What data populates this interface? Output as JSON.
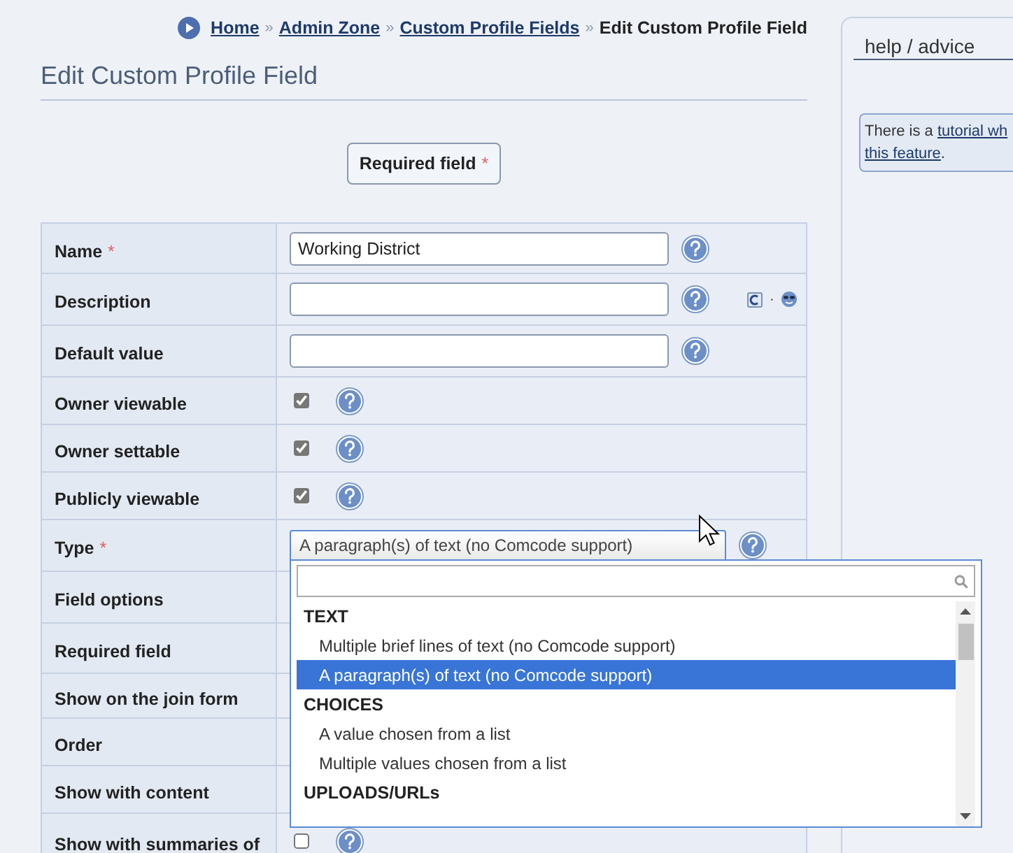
{
  "breadcrumb": {
    "links": [
      "Home",
      "Admin Zone",
      "Custom Profile Fields"
    ],
    "separator": "»",
    "current": "Edit Custom Profile Field"
  },
  "title": "Edit Custom Profile Field",
  "required_legend": {
    "label": "Required field",
    "mark": "*"
  },
  "fields": [
    {
      "label": "Name",
      "required": true,
      "kind": "text",
      "value": "Working District"
    },
    {
      "label": "Description",
      "required": false,
      "kind": "text_tools",
      "tools_separator": "·"
    },
    {
      "label": "Default value",
      "required": false,
      "kind": "text"
    },
    {
      "label": "Owner viewable",
      "required": false,
      "kind": "checkbox",
      "checked": true
    },
    {
      "label": "Owner settable",
      "required": false,
      "kind": "checkbox",
      "checked": true
    },
    {
      "label": "Publicly viewable",
      "required": false,
      "kind": "checkbox",
      "checked": true
    },
    {
      "label": "Type",
      "required": true,
      "kind": "select",
      "value": "A paragraph(s) of text (no Comcode support)",
      "open": true
    },
    {
      "label": "Field options",
      "required": false,
      "kind": "covered"
    },
    {
      "label": "Required field",
      "required": false,
      "kind": "covered"
    },
    {
      "label": "Show on the join form",
      "required": false,
      "kind": "covered"
    },
    {
      "label": "Order",
      "required": false,
      "kind": "covered"
    },
    {
      "label": "Show with content",
      "required": false,
      "kind": "covered"
    },
    {
      "label": "Show with summaries of",
      "required": false,
      "kind": "checkbox",
      "checked": false
    }
  ],
  "dropdown": {
    "groups": [
      {
        "label": "TEXT",
        "options": [
          {
            "label": "Multiple brief lines of text (no Comcode support)",
            "selected": false
          },
          {
            "label": "A paragraph(s) of text (no Comcode support)",
            "selected": true
          }
        ]
      },
      {
        "label": "CHOICES",
        "options": [
          {
            "label": "A value chosen from a list",
            "selected": false
          },
          {
            "label": "Multiple values chosen from a list",
            "selected": false
          }
        ]
      },
      {
        "label": "UPLOADS/URLs"
      }
    ]
  },
  "help": {
    "title": "help / advice",
    "lines": [
      [
        {
          "kind": "text",
          "text": "There is a "
        },
        {
          "kind": "link",
          "text": "tutorial wh"
        }
      ],
      [
        {
          "kind": "link",
          "text": "this feature"
        },
        {
          "kind": "text",
          "text": "."
        }
      ]
    ]
  }
}
